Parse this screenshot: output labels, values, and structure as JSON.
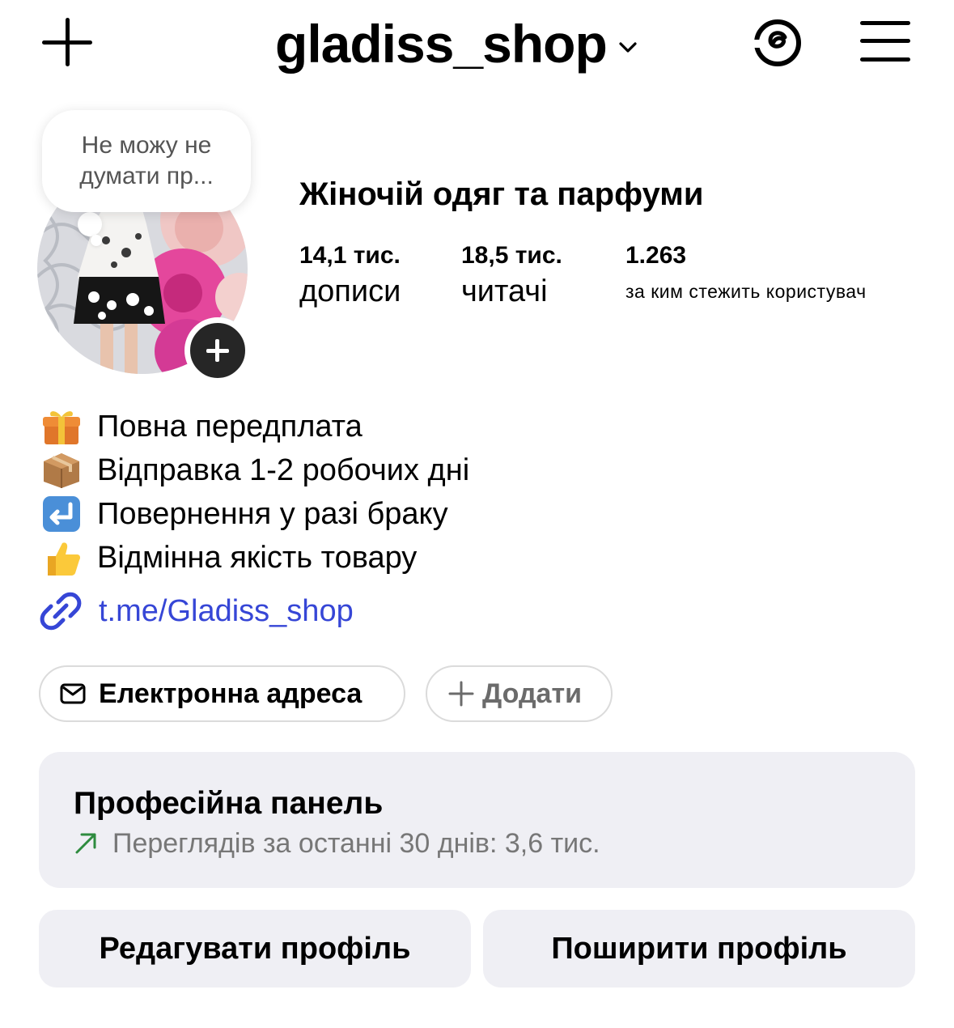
{
  "header": {
    "username": "gladiss_shop",
    "icons": [
      "plus-icon",
      "chevron-down-icon",
      "threads-icon",
      "menu-icon"
    ]
  },
  "note": {
    "text": "Не можу не думати пр..."
  },
  "profile": {
    "display_name": "Жіночій одяг та парфуми",
    "stats": {
      "posts": {
        "value": "14,1 тис.",
        "label": "дописи"
      },
      "followers": {
        "value": "18,5 тис.",
        "label": "читачі"
      },
      "following": {
        "value": "1.263",
        "label": "за ким стежить користувач"
      }
    }
  },
  "bio": {
    "lines": [
      {
        "icon": "gift-icon",
        "text": "Повна передплата"
      },
      {
        "icon": "package-icon",
        "text": "Відправка 1-2 робочих дні"
      },
      {
        "icon": "return-arrow-icon",
        "text": "Повернення у разі браку"
      },
      {
        "icon": "thumbs-up-icon",
        "text": "Відмінна якість товару"
      }
    ],
    "link": "t.me/Gladiss_shop"
  },
  "contact": {
    "email_label": "Електронна адреса",
    "add_label": "Додати"
  },
  "dashboard": {
    "title": "Професійна панель",
    "subtitle": "Переглядів за останні 30 днів: 3,6 тис."
  },
  "actions": {
    "edit_label": "Редагувати профіль",
    "share_label": "Поширити профіль"
  },
  "colors": {
    "link": "#3646d6",
    "button_bg": "#efeff4",
    "trend_arrow": "#2e8b3e"
  }
}
